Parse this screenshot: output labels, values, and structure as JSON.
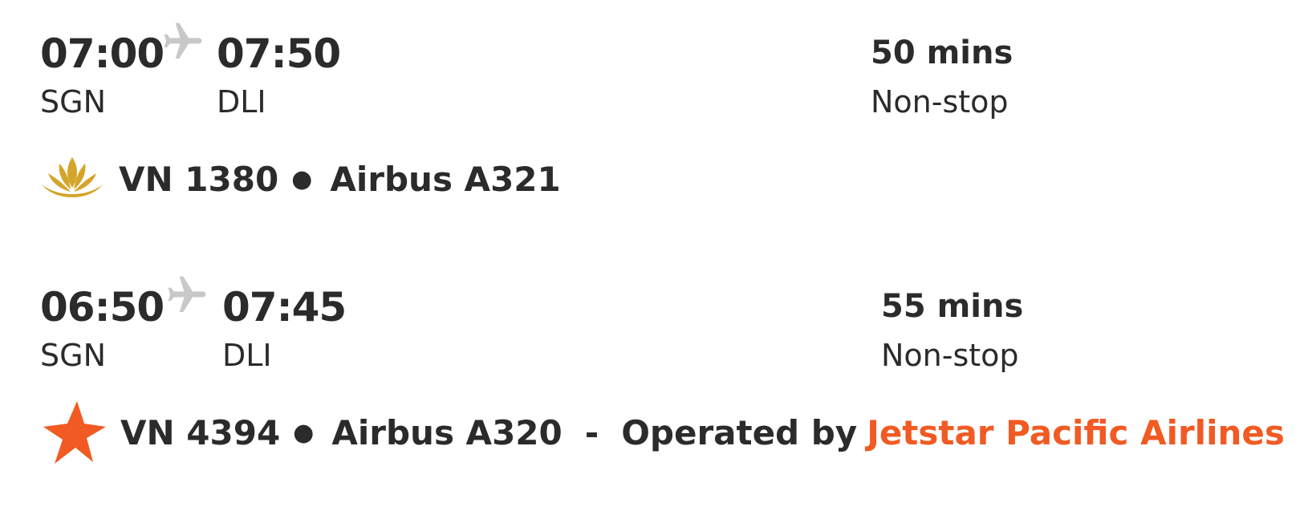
{
  "flights": [
    {
      "depart_time": "07:00",
      "arrive_time": "07:50",
      "depart_code": "SGN",
      "arrive_code": "DLI",
      "duration": "50 mins",
      "stops": "Non-stop",
      "airline_logo": "vietnam-airlines-lotus-icon",
      "flight_number": "VN 1380",
      "aircraft": "Airbus A321"
    },
    {
      "depart_time": "06:50",
      "arrive_time": "07:45",
      "depart_code": "SGN",
      "arrive_code": "DLI",
      "duration": "55 mins",
      "stops": "Non-stop",
      "airline_logo": "jetstar-star-icon",
      "flight_number": "VN 4394",
      "aircraft": "Airbus A320",
      "separator": "-",
      "operated_by_label": "Operated by",
      "operator": "Jetstar Pacific Airlines"
    }
  ],
  "colors": {
    "text": "#2b2b2b",
    "plane_icon": "#c8c8c8",
    "lotus_gold": "#d4a52a",
    "jetstar_orange": "#f15a22"
  }
}
